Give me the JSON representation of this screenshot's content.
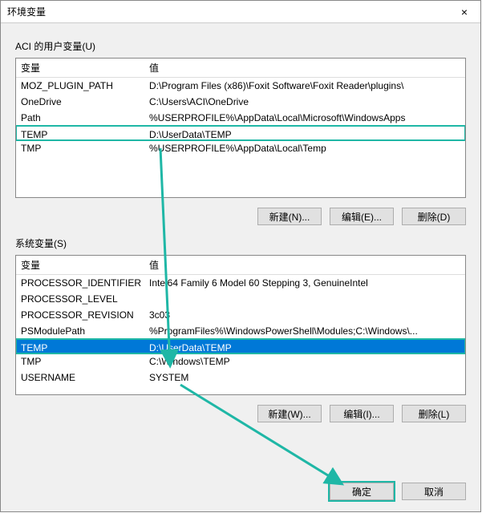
{
  "dialog": {
    "title": "环境变量",
    "close_icon": "×"
  },
  "userVars": {
    "label": "ACI 的用户变量(U)",
    "header_var": "变量",
    "header_val": "值",
    "rows": [
      {
        "var": "MOZ_PLUGIN_PATH",
        "val": "D:\\Program Files (x86)\\Foxit Software\\Foxit Reader\\plugins\\"
      },
      {
        "var": "OneDrive",
        "val": "C:\\Users\\ACI\\OneDrive"
      },
      {
        "var": "Path",
        "val": "%USERPROFILE%\\AppData\\Local\\Microsoft\\WindowsApps"
      },
      {
        "var": "TEMP",
        "val": "D:\\UserData\\TEMP"
      },
      {
        "var": "TMP",
        "val": "%USERPROFILE%\\AppData\\Local\\Temp"
      }
    ],
    "selectedIndex": 3,
    "buttons": {
      "new": "新建(N)...",
      "edit": "编辑(E)...",
      "delete": "删除(D)"
    }
  },
  "sysVars": {
    "label": "系统变量(S)",
    "header_var": "变量",
    "header_val": "值",
    "rows": [
      {
        "var": "PROCESSOR_IDENTIFIER",
        "val": "Intel64 Family 6 Model 60 Stepping 3, GenuineIntel"
      },
      {
        "var": "PROCESSOR_LEVEL",
        "val": ""
      },
      {
        "var": "PROCESSOR_REVISION",
        "val": "3c03"
      },
      {
        "var": "PSModulePath",
        "val": "%ProgramFiles%\\WindowsPowerShell\\Modules;C:\\Windows\\..."
      },
      {
        "var": "TEMP",
        "val": "D:\\UserData\\TEMP"
      },
      {
        "var": "TMP",
        "val": "C:\\Windows\\TEMP"
      },
      {
        "var": "USERNAME",
        "val": "SYSTEM"
      }
    ],
    "selectedIndex": 4,
    "buttons": {
      "new": "新建(W)...",
      "edit": "编辑(I)...",
      "delete": "删除(L)"
    }
  },
  "dialogButtons": {
    "ok": "确定",
    "cancel": "取消"
  },
  "colors": {
    "accent": "#1fb7a6",
    "selection": "#0078d7"
  }
}
